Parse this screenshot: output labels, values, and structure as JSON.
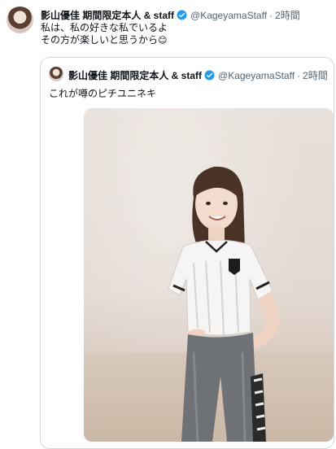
{
  "tweet": {
    "author_name": "影山優佳 期間限定本人 & staff",
    "handle": "@KageyamaStaff",
    "separator": "·",
    "time": "2時間",
    "text_line1": "私は、私の好きな私でいるよ",
    "text_line2": "その方が楽しいと思うから",
    "emoji": "😊"
  },
  "quoted_tweet": {
    "author_name": "影山優佳 期間限定本人 & staff",
    "handle": "@KageyamaStaff",
    "separator": "·",
    "time": "2時間",
    "text": "これが噂のピチユニネキ"
  },
  "colors": {
    "verified": "#1d9bf0",
    "secondary_text": "#536471",
    "border": "#cfd9de"
  },
  "icons": {
    "verified": "verified-badge-icon"
  }
}
